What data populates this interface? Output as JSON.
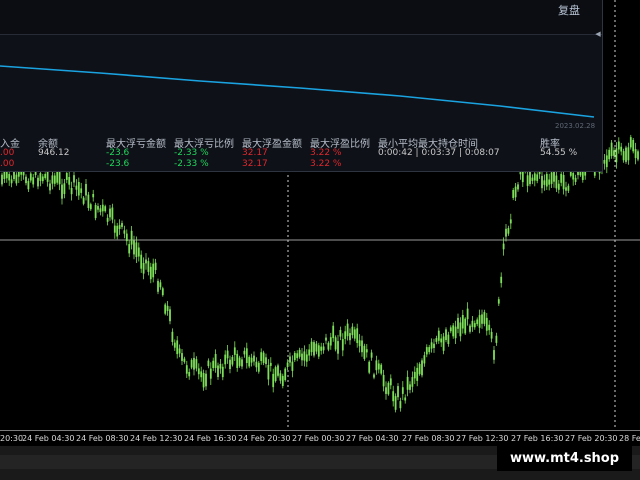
{
  "panel": {
    "restore_button": "复盘",
    "date_label": "2023.02.28",
    "columns": [
      {
        "header": "入金",
        "row1": ".00",
        "row2": ".00",
        "color1": "red",
        "color2": "red"
      },
      {
        "header": "余额",
        "row1": "946.12",
        "row2": "",
        "color1": "white",
        "color2": "white"
      },
      {
        "header": "最大浮亏金额",
        "row1": "-23.6",
        "row2": "-23.6",
        "color1": "green",
        "color2": "green"
      },
      {
        "header": "最大浮亏比例",
        "row1": "-2.33 %",
        "row2": "-2.33 %",
        "color1": "green",
        "color2": "green"
      },
      {
        "header": "最大浮盈金额",
        "row1": "32.17",
        "row2": "32.17",
        "color1": "red",
        "color2": "red"
      },
      {
        "header": "最大浮盈比例",
        "row1": "3.22 %",
        "row2": "3.22 %",
        "color1": "red",
        "color2": "red"
      },
      {
        "header": "最小平均最大持仓时间",
        "row1": "0:00:42 | 0:03:37 | 0:08:07",
        "row2": "",
        "color1": "white",
        "color2": "white"
      },
      {
        "header": "胜率",
        "row1": "54.55 %",
        "row2": "",
        "color1": "white",
        "color2": "white"
      }
    ]
  },
  "time_axis": [
    "20:30",
    "24 Feb 04:30",
    "24 Feb 08:30",
    "24 Feb 12:30",
    "24 Feb 16:30",
    "24 Feb 20:30",
    "27 Feb 00:30",
    "27 Feb 04:30",
    "27 Feb 08:30",
    "27 Feb 12:30",
    "27 Feb 16:30",
    "27 Feb 20:30",
    "28 Fe"
  ],
  "watermark": "www.mt4.shop",
  "colors": {
    "bull": "#7ee05a",
    "bear": "#7ee05a",
    "equity_line": "#1aa3e0",
    "background": "#000000",
    "panel_bg": "#0e1118"
  }
}
